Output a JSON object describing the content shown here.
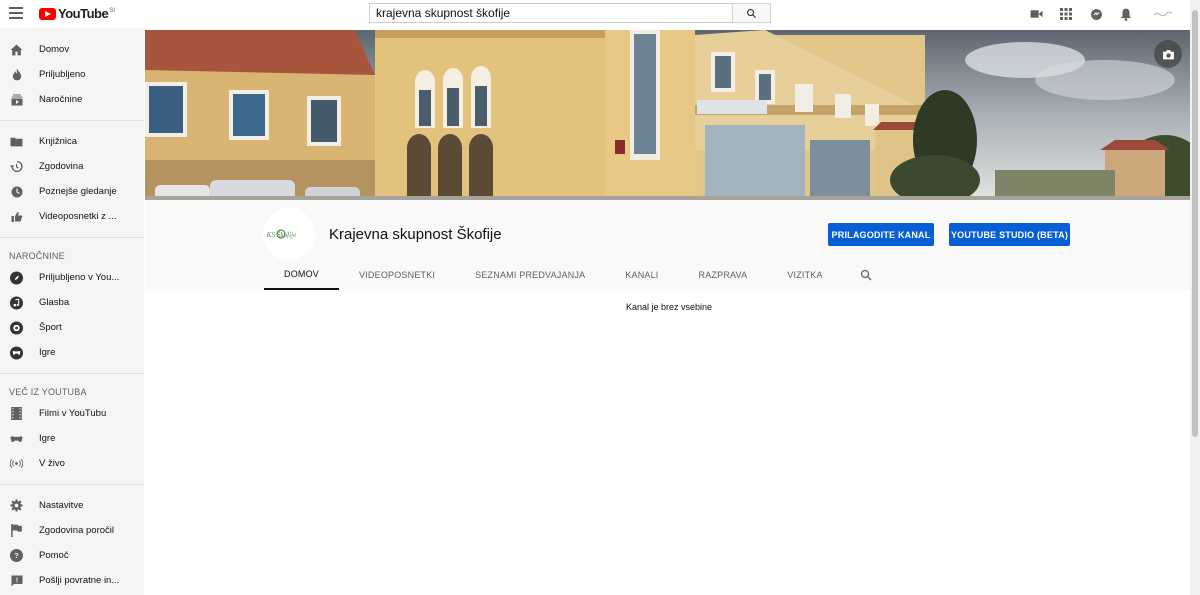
{
  "topbar": {
    "logo_text": "YouTube",
    "logo_country": "SI",
    "search_value": "krajevna skupnost škofije"
  },
  "sidebar": {
    "main_items": [
      {
        "label": "Domov",
        "icon": "home-icon"
      },
      {
        "label": "Priljubljeno",
        "icon": "trending-icon"
      },
      {
        "label": "Naročnine",
        "icon": "subscriptions-icon"
      }
    ],
    "library_items": [
      {
        "label": "Knjižnica",
        "icon": "library-icon"
      },
      {
        "label": "Zgodovina",
        "icon": "history-icon"
      },
      {
        "label": "Poznejše gledanje",
        "icon": "watch-later-icon"
      },
      {
        "label": "Videoposnetki z ...",
        "icon": "liked-icon"
      }
    ],
    "subs_heading": "NAROČNINE",
    "subs_items": [
      {
        "label": "Priljubljeno v You...",
        "icon": "popular-channel-icon"
      },
      {
        "label": "Glasba",
        "icon": "music-channel-icon"
      },
      {
        "label": "Šport",
        "icon": "sport-channel-icon"
      },
      {
        "label": "Igre",
        "icon": "gaming-channel-icon"
      }
    ],
    "more_heading": "VEČ IZ YOUTUBA",
    "more_items": [
      {
        "label": "Filmi v YouTubu",
        "icon": "movies-icon"
      },
      {
        "label": "Igre",
        "icon": "gaming-icon"
      },
      {
        "label": "V živo",
        "icon": "live-icon"
      }
    ],
    "settings_items": [
      {
        "label": "Nastavitve",
        "icon": "gear-icon"
      },
      {
        "label": "Zgodovina poročil",
        "icon": "flag-icon"
      },
      {
        "label": "Pomoč",
        "icon": "help-icon"
      },
      {
        "label": "Pošlji povratne in...",
        "icon": "feedback-icon"
      }
    ]
  },
  "channel": {
    "name": "Krajevna skupnost Škofije",
    "avatar_text": "KS Škofije",
    "customize_label": "PRILAGODITE KANAL",
    "studio_label": "YOUTUBE STUDIO (BETA)",
    "tabs": [
      "DOMOV",
      "VIDEOPOSNETKI",
      "SEZNAMI PREDVAJANJA",
      "KANALI",
      "RAZPRAVA",
      "VIZITKA"
    ],
    "active_tab": 0,
    "empty_message": "Kanal je brez vsebine"
  },
  "colors": {
    "accent_blue": "#065fd4",
    "logo_red": "#ff0000",
    "sidebar_bg": "#f5f5f5"
  }
}
